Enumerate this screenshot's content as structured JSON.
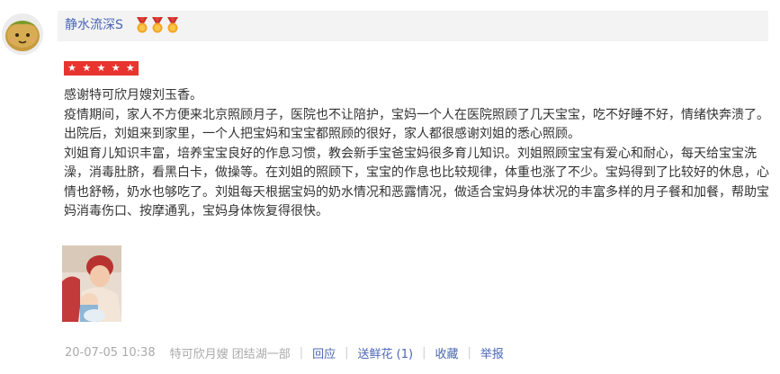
{
  "review": {
    "username": "静水流深S",
    "medal_count": 3,
    "rating": 5,
    "paragraphs": [
      "感谢特可欣月嫂刘玉香。",
      "疫情期间，家人不方便来北京照顾月子，医院也不让陪护，宝妈一个人在医院照顾了几天宝宝，吃不好睡不好，情绪快奔溃了。出院后，刘姐来到家里，一个人把宝妈和宝宝都照顾的很好，家人都很感谢刘姐的悉心照顾。",
      "刘姐育儿知识丰富，培养宝宝良好的作息习惯，教会新手宝爸宝妈很多育儿知识。刘姐照顾宝宝有爱心和耐心，每天给宝宝洗澡，消毒肚脐，看黑白卡，做操等。在刘姐的照顾下，宝宝的作息也比较规律，体重也涨了不少。宝妈得到了比较好的休息，心情也舒畅，奶水也够吃了。刘姐每天根据宝妈的奶水情况和恶露情况，做适合宝妈身体状况的丰富多样的月子餐和加餐，帮助宝妈消毒伤口、按摩通乳，宝妈身体恢复得很快。"
    ]
  },
  "footer": {
    "timestamp": "20-07-05 10:38",
    "source": "特可欣月嫂 团结湖一部",
    "separator": "|",
    "reply_label": "回应",
    "flower_label": "送鲜花 (1)",
    "favorite_label": "收藏",
    "report_label": "举报"
  },
  "colors": {
    "link": "#4a66b5",
    "rating_bg": "#e8342f",
    "header_band": "#f3f3f3",
    "meta_text": "#aaaaaa"
  },
  "icons": {
    "avatar": "potato-avatar",
    "medal": "medal-icon",
    "star": "star-icon"
  }
}
